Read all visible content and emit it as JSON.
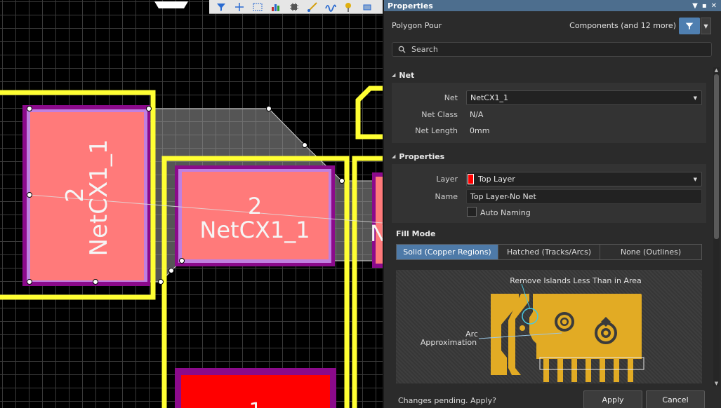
{
  "canvas": {
    "designators": [
      {
        "number": "2",
        "net": "NetCX1_1"
      },
      {
        "number": "2",
        "net": "NetCX1_1"
      },
      {
        "number": "",
        "net": "N"
      },
      {
        "number": "1",
        "net": ""
      }
    ],
    "colors": {
      "track": "#ffff33",
      "pad": "#ff7a7a",
      "pad_solder": "#8b0a8b",
      "pad_mask": "#c080e0",
      "polygon": "#b0b0b0",
      "grid": "#3a3a3a"
    }
  },
  "toolbar": {
    "icons": [
      "filter-icon",
      "crosshair-icon",
      "select-rect-icon",
      "chart-icon",
      "chip-icon",
      "route-icon",
      "wave-icon",
      "pin-icon",
      "rect-shape-icon"
    ]
  },
  "panel": {
    "title": "Properties",
    "object_kind": "Polygon Pour",
    "filter_label": "Components (and 12 more)",
    "search_placeholder": "Search",
    "net_section": {
      "header": "Net",
      "net_label": "Net",
      "net_value": "NetCX1_1",
      "net_class_label": "Net Class",
      "net_class_value": "N/A",
      "net_length_label": "Net Length",
      "net_length_value": "0mm"
    },
    "props_section": {
      "header": "Properties",
      "layer_label": "Layer",
      "layer_value": "Top Layer",
      "layer_color": "#ff0000",
      "name_label": "Name",
      "name_value": "Top Layer-No Net",
      "auto_naming_label": "Auto Naming"
    },
    "fill_mode": {
      "label": "Fill Mode",
      "options": [
        "Solid (Copper Regions)",
        "Hatched (Tracks/Arcs)",
        "None (Outlines)"
      ],
      "selected": "Solid (Copper Regions)"
    },
    "illustration": {
      "remove_islands_label": "Remove Islands Less Than in Area",
      "arc_label": "Arc",
      "approx_label": "Approximation"
    },
    "footer": {
      "pending_text": "Changes pending. Apply?",
      "apply_label": "Apply",
      "cancel_label": "Cancel"
    }
  }
}
